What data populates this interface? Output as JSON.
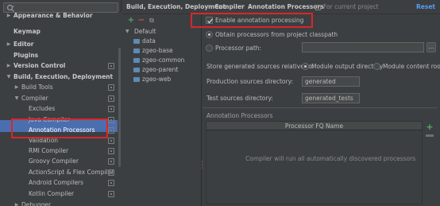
{
  "sidebar": {
    "search": {
      "placeholder": ""
    },
    "items": [
      {
        "label": "Appearance & Behavior",
        "expanded": false,
        "bold": true,
        "project_icon": false
      },
      {
        "label": "Keymap",
        "expanded": null,
        "bold": true,
        "project_icon": false
      },
      {
        "label": "Editor",
        "expanded": false,
        "bold": true,
        "project_icon": false
      },
      {
        "label": "Plugins",
        "expanded": null,
        "bold": true,
        "project_icon": false
      },
      {
        "label": "Version Control",
        "expanded": false,
        "bold": true,
        "project_icon": true
      },
      {
        "label": "Build, Execution, Deployment",
        "expanded": true,
        "bold": true,
        "project_icon": false
      },
      {
        "label": "Build Tools",
        "expanded": false,
        "bold": false,
        "project_icon": true
      },
      {
        "label": "Compiler",
        "expanded": true,
        "bold": false,
        "project_icon": true
      },
      {
        "label": "Excludes",
        "expanded": null,
        "bold": false,
        "project_icon": true
      },
      {
        "label": "Java Compiler",
        "expanded": null,
        "bold": false,
        "project_icon": true
      },
      {
        "label": "Annotation Processors",
        "expanded": null,
        "bold": false,
        "project_icon": true,
        "selected": true
      },
      {
        "label": "Validation",
        "expanded": null,
        "bold": false,
        "project_icon": true
      },
      {
        "label": "RMI Compiler",
        "expanded": null,
        "bold": false,
        "project_icon": true
      },
      {
        "label": "Groovy Compiler",
        "expanded": null,
        "bold": false,
        "project_icon": true
      },
      {
        "label": "ActionScript & Flex Compiler",
        "expanded": null,
        "bold": false,
        "project_icon": true
      },
      {
        "label": "Android Compilers",
        "expanded": null,
        "bold": false,
        "project_icon": true
      },
      {
        "label": "Kotlin Compiler",
        "expanded": null,
        "bold": false,
        "project_icon": true
      },
      {
        "label": "Debugger",
        "expanded": false,
        "bold": false,
        "project_icon": false
      }
    ]
  },
  "header": {
    "breadcrumb": [
      "Build, Execution, Deployment",
      "Compiler",
      "Annotation Processors"
    ],
    "separator": "›",
    "for_current_project": "For current project",
    "reset_label": "Reset"
  },
  "modules": {
    "toolbar": {
      "add": "+",
      "remove": "−",
      "copy": "⧉"
    },
    "root": "Default",
    "children": [
      "data",
      "zgeo-base",
      "zgeo-common",
      "zgeo-parent",
      "zgeo-web"
    ]
  },
  "panel": {
    "enable_label": "Enable annotation processing",
    "enable_checked": true,
    "obtain_classpath_label": "Obtain processors from project classpath",
    "processor_path_label": "Processor path:",
    "processor_path_value": "",
    "browse_label": "...",
    "store_generated_label": "Store generated sources relative to:",
    "module_output_label": "Module output directory",
    "module_content_root_label": "Module content root",
    "production_sources_label": "Production sources directory:",
    "production_sources_value": "generated",
    "test_sources_label": "Test sources directory:",
    "test_sources_value": "generated_tests",
    "annotation_processors_label": "Annotation Processors",
    "fq_name_header": "Processor FQ Name",
    "empty_text": "Compiler will run all automatically discovered processors",
    "add_label": "+"
  },
  "colors": {
    "background": "#3c3f41",
    "selection": "#4b6eaf",
    "highlight_box": "#d9262b",
    "link": "#589df6",
    "add_green": "#59a869"
  }
}
